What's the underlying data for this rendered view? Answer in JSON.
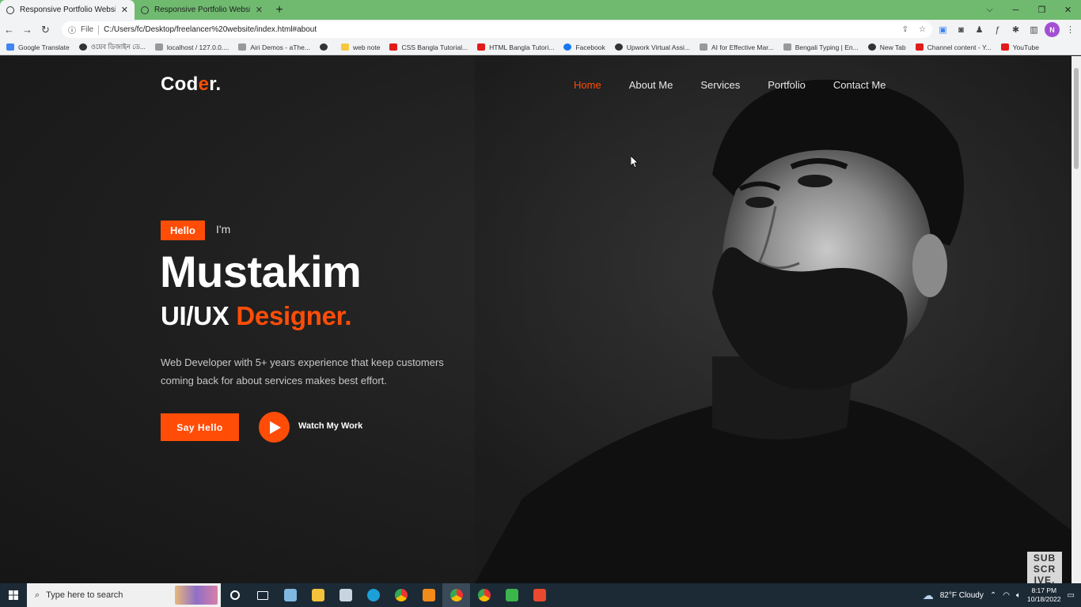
{
  "browser": {
    "tabs": [
      {
        "title": "Responsive Portfolio Website",
        "active": true
      },
      {
        "title": "Responsive Portfolio Website",
        "active": false
      }
    ],
    "address": {
      "scheme_label": "File",
      "url": "C:/Users/fc/Desktop/freelancer%20website/index.html#about"
    },
    "profile_initial": "N",
    "bookmarks": [
      {
        "label": "Google Translate",
        "icon": "translate-icon"
      },
      {
        "label": "ওয়েব ডিজাইন ডে...",
        "icon": "globe-icon"
      },
      {
        "label": "localhost / 127.0.0....",
        "icon": "database-icon"
      },
      {
        "label": "Airi Demos - aThe...",
        "icon": "bookmark-icon"
      },
      {
        "label": "",
        "icon": "globe-icon"
      },
      {
        "label": "web note",
        "icon": "folder-icon"
      },
      {
        "label": "CSS Bangla Tutorial...",
        "icon": "youtube-icon"
      },
      {
        "label": "HTML Bangla Tutori...",
        "icon": "youtube-icon"
      },
      {
        "label": "Facebook",
        "icon": "facebook-icon"
      },
      {
        "label": "Upwork Virtual Assi...",
        "icon": "globe-icon"
      },
      {
        "label": "AI for Effective Mar...",
        "icon": "k-icon"
      },
      {
        "label": "Bengali Typing | En...",
        "icon": "typing-icon"
      },
      {
        "label": "New Tab",
        "icon": "globe-icon"
      },
      {
        "label": "Channel content - Y...",
        "icon": "youtube-icon"
      },
      {
        "label": "YouTube",
        "icon": "youtube-icon"
      }
    ]
  },
  "site": {
    "logo": {
      "prefix": "Cod",
      "accent": "e",
      "suffix": "r."
    },
    "nav": [
      {
        "label": "Home",
        "active": true
      },
      {
        "label": "About Me",
        "active": false
      },
      {
        "label": "Services",
        "active": false
      },
      {
        "label": "Portfolio",
        "active": false
      },
      {
        "label": "Contact Me",
        "active": false
      }
    ],
    "hero": {
      "badge": "Hello",
      "intro": "I'm",
      "name": "Mustakim",
      "role_prefix": "UI/UX ",
      "role_accent": "Designer.",
      "description": "Web Developer with 5+ years experience that keep customers coming back for about services makes best effort.",
      "cta_label": "Say Hello",
      "watch_label": "Watch My Work"
    },
    "accent_color": "#ff4d08"
  },
  "overlay": {
    "subscribe": [
      "SUB",
      "SCR",
      "IVE."
    ]
  },
  "taskbar": {
    "search_placeholder": "Type here to search",
    "weather": "82°F  Cloudy",
    "time": "8:17 PM",
    "date": "10/18/2022"
  }
}
